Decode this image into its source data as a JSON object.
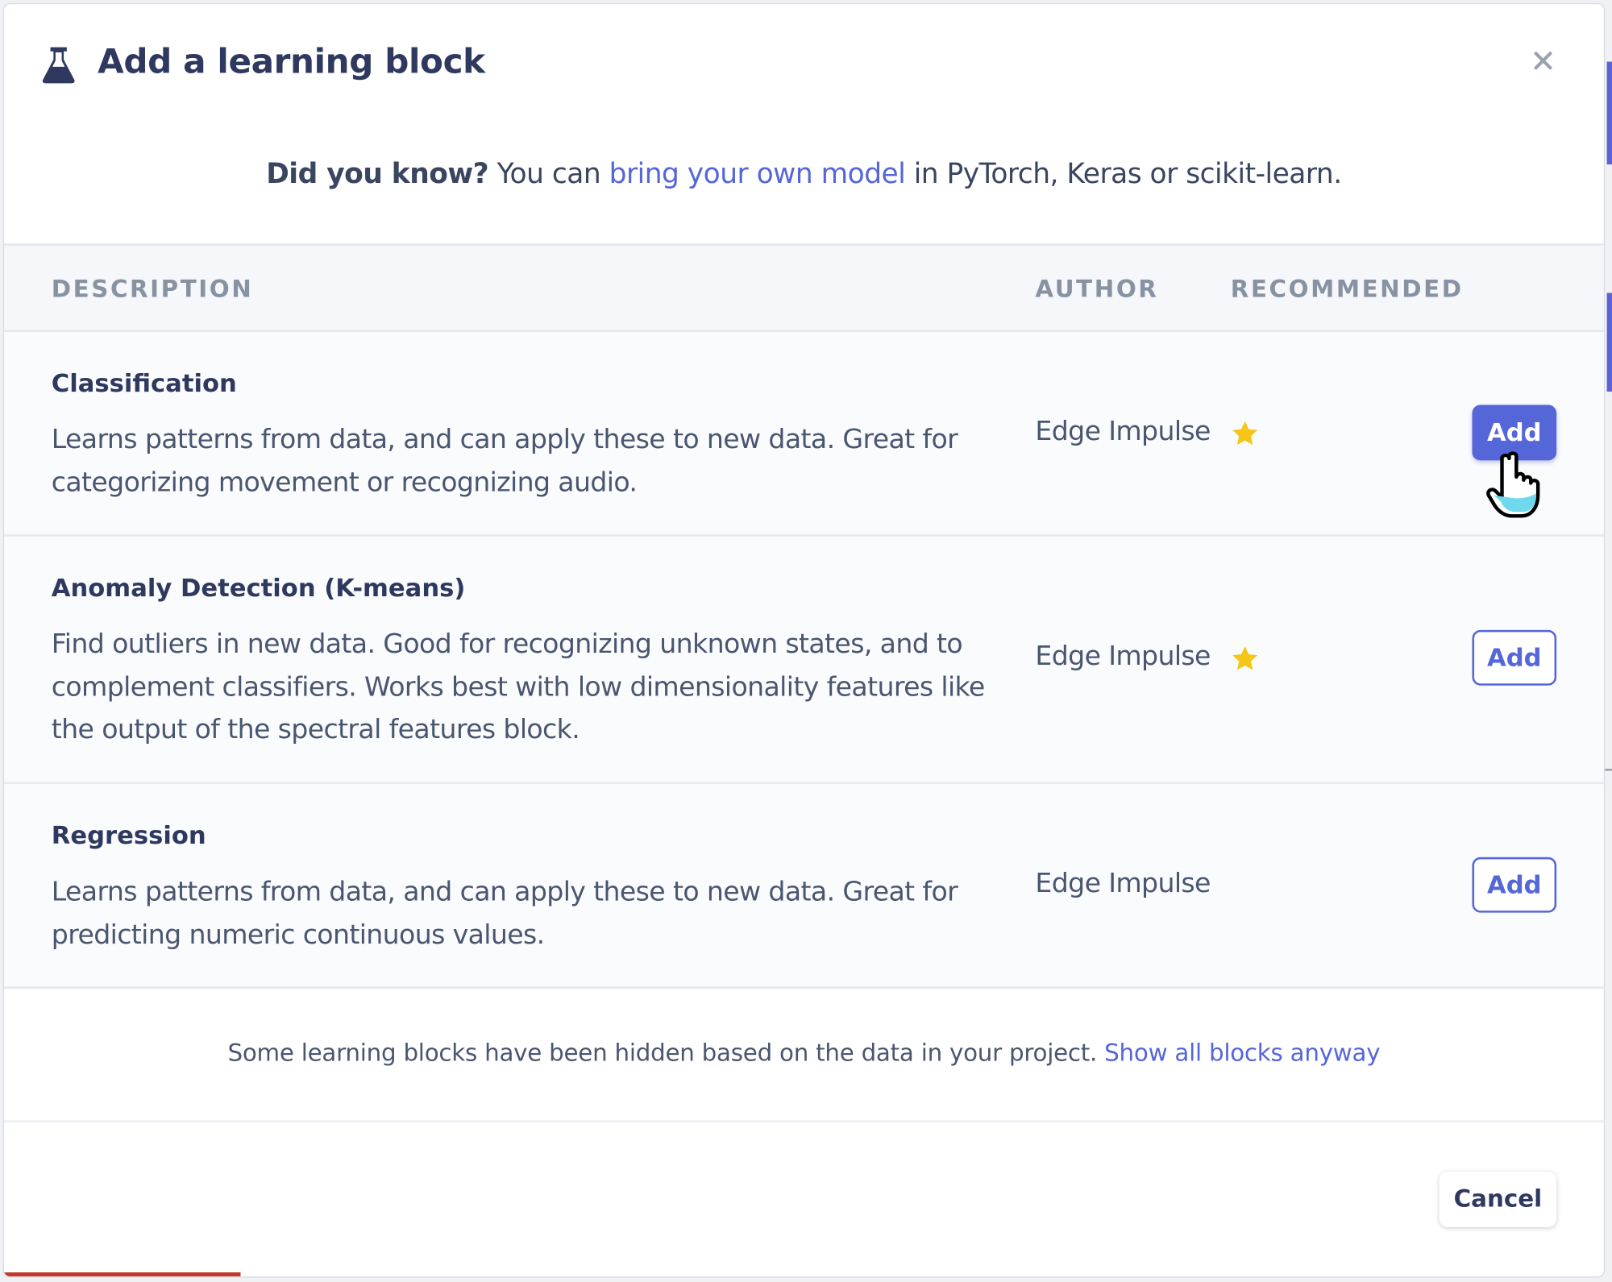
{
  "modal": {
    "title": "Add a learning block",
    "icon": "flask-icon",
    "close_icon": "close-icon"
  },
  "tip": {
    "prefix_bold": "Did you know?",
    "text_before_link": " You can ",
    "link_text": "bring your own model",
    "text_after_link": " in PyTorch, Keras or scikit-learn."
  },
  "table": {
    "headers": {
      "description": "DESCRIPTION",
      "author": "AUTHOR",
      "recommended": "RECOMMENDED"
    },
    "rows": [
      {
        "title": "Classification",
        "description": "Learns patterns from data, and can apply these to new data. Great for categorizing movement or recognizing audio.",
        "author": "Edge Impulse",
        "recommended": true,
        "add_label": "Add",
        "add_style": "primary"
      },
      {
        "title": "Anomaly Detection (K-means)",
        "description": "Find outliers in new data. Good for recognizing unknown states, and to complement classifiers. Works best with low dimensionality features like the output of the spectral features block.",
        "author": "Edge Impulse",
        "recommended": true,
        "add_label": "Add",
        "add_style": "outline"
      },
      {
        "title": "Regression",
        "description": "Learns patterns from data, and can apply these to new data. Great for predicting numeric continuous values.",
        "author": "Edge Impulse",
        "recommended": false,
        "add_label": "Add",
        "add_style": "outline"
      }
    ]
  },
  "hidden_note": {
    "text": "Some learning blocks have been hidden based on the data in your project. ",
    "link_text": "Show all blocks anyway"
  },
  "footer": {
    "cancel_label": "Cancel"
  },
  "colors": {
    "accent": "#5566d9",
    "star": "#f5c518",
    "title": "#2f3960",
    "progress": "#c0392b"
  }
}
